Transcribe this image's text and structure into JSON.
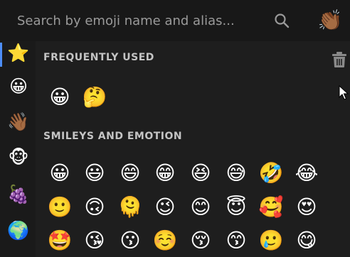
{
  "search": {
    "placeholder": "Search by emoji name and alias...",
    "value": "",
    "skin_tone_emoji": "👏🏾"
  },
  "categories": [
    {
      "emoji": "⭐"
    },
    {
      "emoji": "😀"
    },
    {
      "emoji": "👋🏾"
    },
    {
      "emoji": "🐵"
    },
    {
      "emoji": "🍇"
    },
    {
      "emoji": "🌍"
    }
  ],
  "sections": {
    "frequent": {
      "title": "FREQUENTLY USED",
      "emojis": [
        "😀",
        "🤔"
      ]
    },
    "smileys": {
      "title": "SMILEYS AND EMOTION",
      "rows": [
        [
          "😀",
          "😃",
          "😄",
          "😁",
          "😆",
          "😅",
          "🤣",
          "😂"
        ],
        [
          "🙂",
          "🙃",
          "🫠",
          "😉",
          "😊",
          "😇",
          "🥰",
          "😍"
        ],
        [
          "🤩",
          "😘",
          "😗",
          "☺️",
          "😚",
          "😙",
          "🥲",
          "😋"
        ]
      ]
    }
  },
  "colors": {
    "background": "#1e1e1e",
    "search_background": "#181818",
    "rail_background": "#1a1a1a",
    "accent": "#4d8ef7",
    "section_title": "#c4c4c4"
  }
}
